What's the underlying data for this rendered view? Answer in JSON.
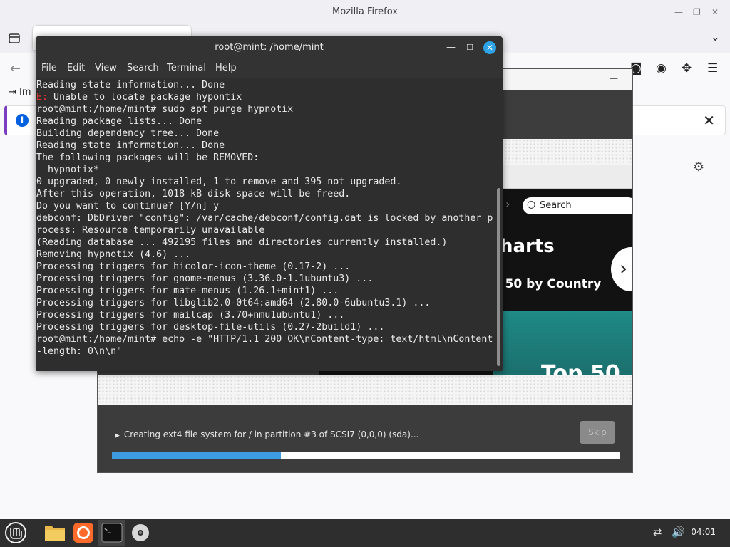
{
  "firefox": {
    "title": "Mozilla Firefox",
    "bookmark_label": "Im",
    "notification_close": "✕"
  },
  "installer": {
    "search_label": "Search",
    "heading_partial": "harts",
    "subheading_partial": "o 50 by Country",
    "card_text": "Top 50",
    "status_text": "Creating ext4 file system for / in partition #3 of SCSI7 (0,0,0) (sda)...",
    "skip_label": "Skip",
    "progress_fraction": 0.333
  },
  "terminal": {
    "title": "root@mint: /home/mint",
    "menu": [
      "File",
      "Edit",
      "Search",
      "Terminal",
      "Help"
    ],
    "error_prefix": "E:",
    "lines": [
      "Reading state information... Done",
      " Unable to locate package hypontix",
      "root@mint:/home/mint# sudo apt purge hypnotix",
      "Reading package lists... Done",
      "Building dependency tree... Done",
      "Reading state information... Done",
      "The following packages will be REMOVED:",
      "  hypnotix*",
      "0 upgraded, 0 newly installed, 1 to remove and 395 not upgraded.",
      "After this operation, 1018 kB disk space will be freed.",
      "Do you want to continue? [Y/n] y",
      "debconf: DbDriver \"config\": /var/cache/debconf/config.dat is locked by another p",
      "rocess: Resource temporarily unavailable",
      "(Reading database ... 492195 files and directories currently installed.)",
      "Removing hypnotix (4.6) ...",
      "Processing triggers for hicolor-icon-theme (0.17-2) ...",
      "Processing triggers for gnome-menus (3.36.0-1.1ubuntu3) ...",
      "Processing triggers for mate-menus (1.26.1+mint1) ...",
      "Processing triggers for libglib2.0-0t64:amd64 (2.80.0-6ubuntu3.1) ...",
      "Processing triggers for mailcap (3.70+nmu1ubuntu1) ...",
      "Processing triggers for desktop-file-utils (0.27-2build1) ...",
      "root@mint:/home/mint# echo -e \"HTTP/1.1 200 OK\\nContent-type: text/html\\nContent",
      "-length: 0\\n\\n\""
    ]
  },
  "taskbar": {
    "clock": "04:01"
  }
}
